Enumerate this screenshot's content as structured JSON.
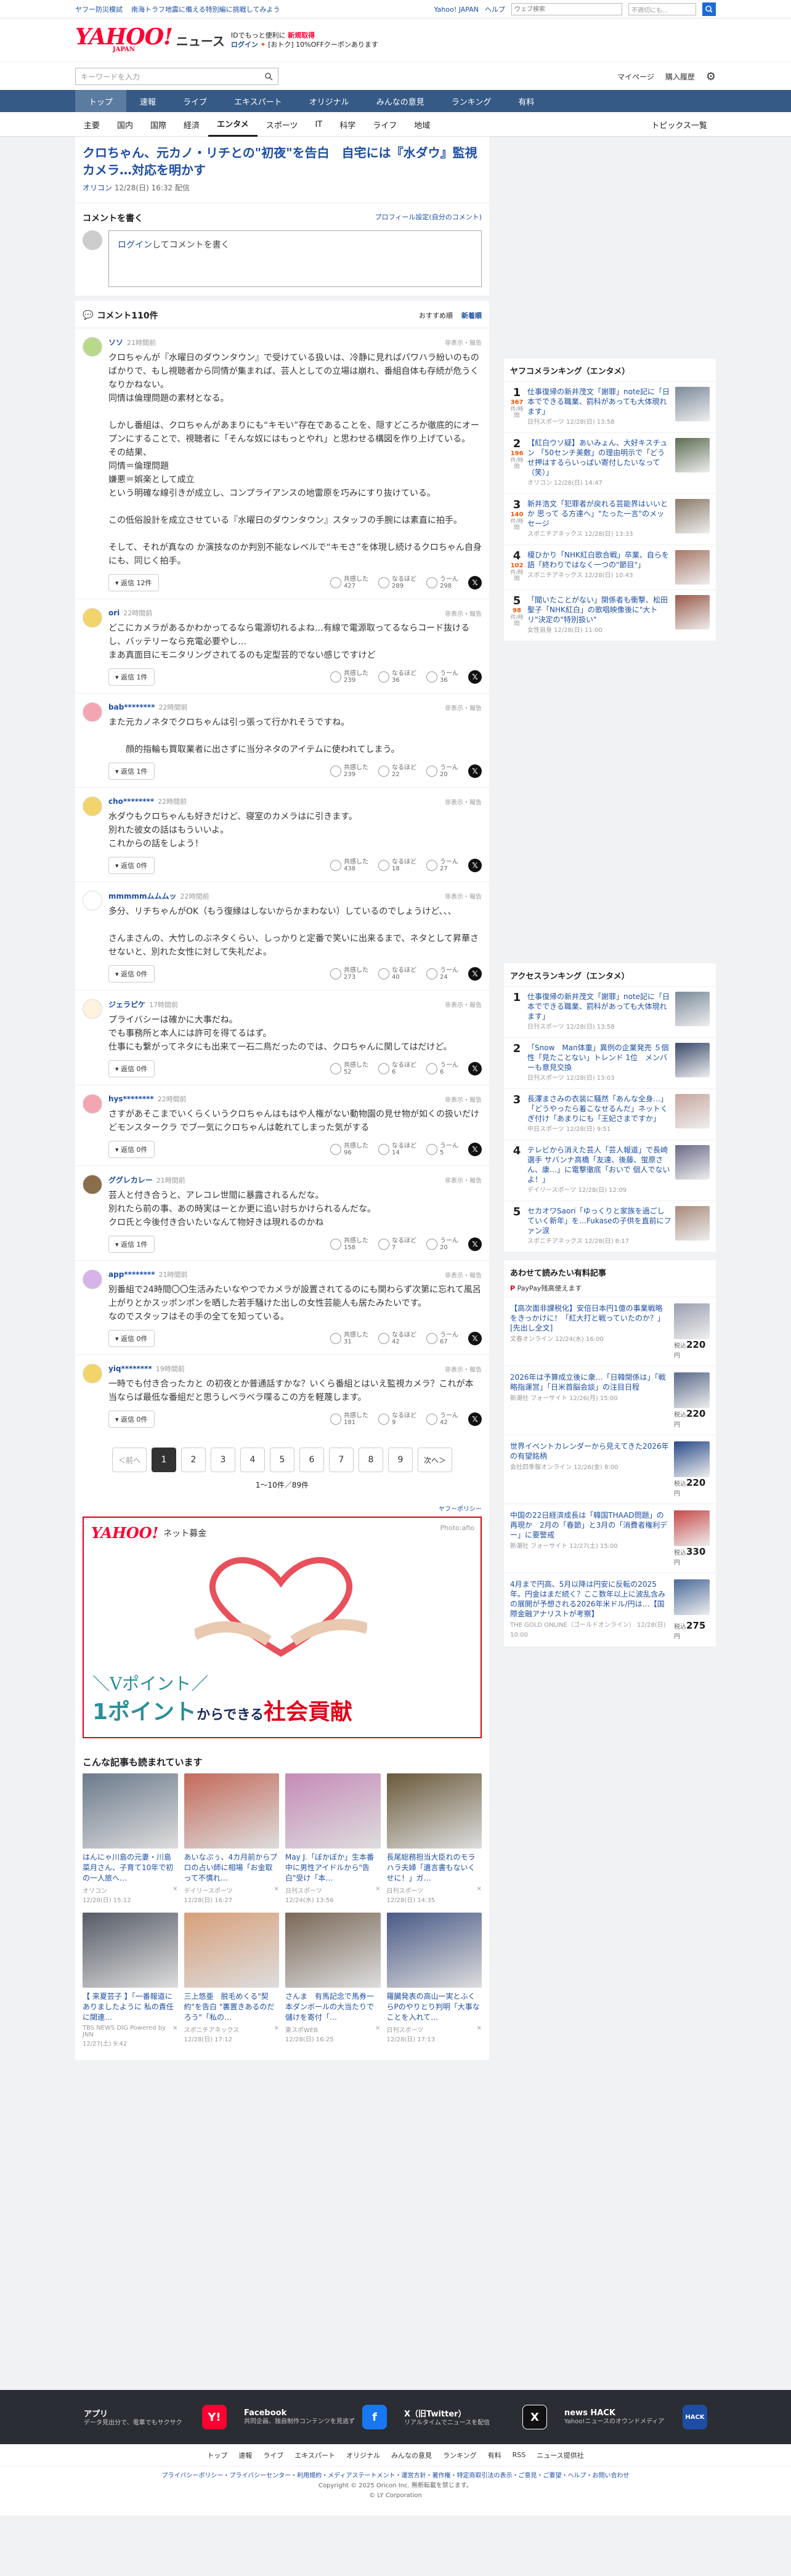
{
  "topbar": {
    "ticker": [
      "ヤフー防災模試",
      "南海トラフ地震に備える特別編に挑戦してみよう"
    ],
    "yahoo": "Yahoo! JAPAN",
    "help": "ヘルプ",
    "search_ph": "ウェブ検索",
    "toggle": "不適切にも..."
  },
  "header": {
    "logo": "YAHOO!",
    "logo_sub": "JAPAN",
    "news": "ニュース",
    "promo1": "IDでもっと便利に",
    "promo1b": "新規取得",
    "promo2": "ログイン",
    "promo3": "[おトク] 10%OFFクーポンあります"
  },
  "searchrow": {
    "ph": "キーワードを入力",
    "mypage": "マイページ",
    "history": "購入履歴"
  },
  "nav": [
    "トップ",
    "速報",
    "ライブ",
    "エキスパート",
    "オリジナル",
    "みんなの意見",
    "ランキング",
    "有料"
  ],
  "subnav": [
    "主要",
    "国内",
    "国際",
    "経済",
    "エンタメ",
    "スポーツ",
    "IT",
    "科学",
    "ライフ",
    "地域"
  ],
  "subnav_right": "トピックス一覧",
  "article": {
    "title": "クロちゃん、元カノ・リチとの\"初夜\"を告白　自宅には『水ダウ』監視カメラ…対応を明かす",
    "source": "オリコン",
    "time": "12/28(日) 16:32 配信"
  },
  "compose": {
    "title": "コメントを書く",
    "profile": "プロフィール設定(自分のコメント)",
    "login": "ログイン",
    "prompt": "してコメントを書く"
  },
  "clist": {
    "title": "コメント110件",
    "sort1": "おすすめ順",
    "sort2": "新着順"
  },
  "react_labels": [
    "共感した",
    "なるほど",
    "うーん"
  ],
  "comments": [
    {
      "user": "ソソ",
      "time": "21時間前",
      "report": "非表示・報告",
      "text": "クロちゃんが『水曜日のダウンタウン』で受けている扱いは、冷静に見ればパワハラ紛いのものばかりで、もし視聴者から同情が集まれば、芸人としての立場は崩れ、番組自体も存続が危うくなりかねない。\n同情は倫理問題の素材となる。\n\nしかし番組は、クロちゃんがあまりにも“キモい”存在であることを、隠すどころか徹底的にオープンにすることで、視聴者に「そんな奴にはもっとやれ」と思わせる構図を作り上げている。\nその結果、\n同情＝倫理問題\n嫌悪＝娯楽として成立\nという明確な線引きが成立し、コンプライアンスの地雷原を巧みにすり抜けている。\n\nこの低俗設計を成立させている『水曜日のダウンタウン』スタッフの手腕には素直に拍手。\n\nそして、それが真なの か演技なのか判別不能なレベルで“キモさ”を体現し続けるクロちゃん自身にも、同じく拍手。",
      "reply": "返信 12件",
      "a": "427",
      "b": "289",
      "c": "298",
      "av": "#b9d98a"
    },
    {
      "user": "ori",
      "time": "22時間前",
      "report": "非表示・報告",
      "text": "どこにカメラがあるかわかってるなら電源切れるよね…有線で電源取ってるならコード抜けるし、バッテリーなら充電必要やし…\nまあ真面目にモニタリングされてるのも定型芸的でない感じですけど",
      "reply": "返信 1件",
      "a": "239",
      "b": "36",
      "c": "36",
      "av": "#f2d46a"
    },
    {
      "user": "bab********",
      "time": "22時間前",
      "report": "非表示・報告",
      "text": "また元カノネタでクロちゃんは引っ張って行かれそうですね。\n\n　　顔的指輪も買取業者に出さずに当分ネタのアイテムに使われてしまう。",
      "reply": "返信 1件",
      "a": "239",
      "b": "22",
      "c": "20",
      "av": "#f3a6b2"
    },
    {
      "user": "cho********",
      "time": "22時間前",
      "report": "非表示・報告",
      "text": "水ダウもクロちゃんも好きだけど、寝室のカメラはに引きます。\n別れた彼女の話はもういいよ。\nこれからの話をしよう！",
      "reply": "返信 0件",
      "a": "438",
      "b": "18",
      "c": "27",
      "av": "#f2d46a"
    },
    {
      "user": "mmmmmムムムッ",
      "time": "22時間前",
      "report": "非表示・報告",
      "text": "多分、リチちゃんがOK（もう復縁はしないからかまわない）しているのでしょうけど、、、\n\nさんまさんの、大竹しのぶネタくらい、しっかりと定番で笑いに出来るまで、ネタとして昇華させないと、別れた女性に対して失礼だよ。",
      "reply": "返信 0件",
      "a": "273",
      "b": "40",
      "c": "24",
      "av": "#ffffff"
    },
    {
      "user": "ジェラピケ",
      "time": "17時間前",
      "report": "非表示・報告",
      "text": "プライバシーは確かに大事だね。\nでも事務所と本人には許可を得てるはず。\n仕事にも繋がってネタにも出来て一石二鳥だったのでは、クロちゃんに関してはだけど。",
      "reply": "返信 0件",
      "a": "52",
      "b": "6",
      "c": "6",
      "av": "#fff3e0"
    },
    {
      "user": "hys********",
      "time": "22時間前",
      "report": "非表示・報告",
      "text": "さすがあそこまでいくらくいうクロちゃんはもはや人権がない動物園の見せ物が如くの扱いだけどモンスタークラ でブ一気にクロちゃんは乾れてしまった気がする",
      "reply": "返信 0件",
      "a": "96",
      "b": "14",
      "c": "5",
      "av": "#f3a6b2"
    },
    {
      "user": "ググレカレー",
      "time": "21時間前",
      "report": "非表示・報告",
      "text": "芸人と付き合うと、アレコレ世間に暴露されるんだな。\n別れたら前の事、あの時実はーとか更に追い討ちかけられるんだな。\nクロ氏と今後付き合いたいなんて物好きは現れるのかね",
      "reply": "返信 1件",
      "a": "158",
      "b": "7",
      "c": "20",
      "av": "#8a6d4a"
    },
    {
      "user": "app********",
      "time": "21時間前",
      "report": "非表示・報告",
      "text": "別番組で24時間〇〇生活みたいなやつでカメラが設置されてるのにも関わらず次第に忘れて風呂上がりとかスッポンポンを晒した若手騒けた出しの女性芸能人も居たみたいです。\nなのでスタッフはその手の全てを知っている。",
      "reply": "返信 0件",
      "a": "31",
      "b": "42",
      "c": "67",
      "av": "#d6b3e8"
    },
    {
      "user": "yiq********",
      "time": "19時間前",
      "report": "非表示・報告",
      "text": "一時でも付き合ったカと の初夜とか普通話すかな？いくら番組とはいえ監視カメラ？これが本当ならば最低な番組だと思うしベラベラ喋るこの方を軽蔑します。",
      "reply": "返信 0件",
      "a": "181",
      "b": "9",
      "c": "42",
      "av": "#f2d46a"
    }
  ],
  "pager": {
    "prev": "＜前へ",
    "next": "次へ＞",
    "pages": [
      "1",
      "2",
      "3",
      "4",
      "5",
      "6",
      "7",
      "8",
      "9"
    ],
    "count": "1〜10件／89件"
  },
  "ad": {
    "policy": "ヤフーポリシー",
    "brand": "YAHOO!",
    "brand_sub": "ネット募金",
    "photo": "Photo:afio",
    "line1": "＼Vポイント／",
    "line2a": "1ポイント",
    "line2b": "からできる",
    "line2c": "社会貢献"
  },
  "recs_title": "こんな記事も読まれています",
  "recs": [
    {
      "t": "はんにゃ川島の元妻・川島菜月さん、子育て10年で初の一人旅へ…",
      "s": "オリコン",
      "d": "12/28(日) 15:12",
      "c": "#6b7a8c"
    },
    {
      "t": "あいなぷぅ、4カ月前からプロの占い師に相場「お金取って不慣れ…",
      "s": "デイリースポーツ",
      "d": "12/28(日) 16:27",
      "c": "#c46a5a"
    },
    {
      "t": "May J.「ぼかぼか」生本番中に男性アイドルから\"告白\"受け「本…",
      "s": "日刊スポーツ",
      "d": "12/24(水) 13:56",
      "c": "#c68ab8"
    },
    {
      "t": "長尾総務担当大臣れのモラハラ夫婦「遺言書もないくせに！」ガ…",
      "s": "日刊スポーツ",
      "d": "12/28(日) 14:35",
      "c": "#6a5a3a"
    },
    {
      "t": "【 来夏芸子 】「一番報道にありましたように 私の責任に関連…",
      "s": "TBS NEWS DIG Powered by JNN",
      "d": "12/27(土) 9:42",
      "c": "#555b66"
    },
    {
      "t": "三上悠亜　脱毛めくる\"契約\"を告白 \"裏置きあるのだろう\"「私の…",
      "s": "スポニチアネックス",
      "d": "12/28(日) 17:12",
      "c": "#d8a07a"
    },
    {
      "t": "さんま　有馬記念で馬券一本ダンボールの大当たりで儲けを寄付「…",
      "s": "東スポWEB",
      "d": "12/28(日) 16:25",
      "c": "#7a6858"
    },
    {
      "t": "羅臓発表の高山一実とふくらPのやりとり判明「大事なことを入れて…",
      "s": "日刊スポーツ",
      "d": "12/28(日) 17:13",
      "c": "#4a5a88"
    }
  ],
  "ranking_title": "ヤフコメランキング（エンタメ）",
  "ranking": [
    {
      "n": "1",
      "cnt": "367",
      "t": "仕事復帰の新井茂文「謝罪」note記に「日本でできる職業、罰科があっても大体現れます」",
      "src": "日刊スポーツ 12/28(日) 13:58",
      "c": "#7b8a9a"
    },
    {
      "n": "2",
      "cnt": "196",
      "t": "【紅白ウソ疑】あいみょん、大好キスチュン 「50センチ美敷」の理由明示で「どうせ押はするらいっぱい寄付したいなって（笑）」",
      "src": "オリコン 12/28(日) 14:47",
      "c": "#5b6d52"
    },
    {
      "n": "3",
      "cnt": "140",
      "t": "新井浩文「犯罪者が戻れる芸能界はいいとか 思って る方達へ」\"たった一言\"のメッセージ",
      "src": "スポニチアネックス 12/28(日) 13:33",
      "c": "#8a7a68"
    },
    {
      "n": "4",
      "cnt": "102",
      "t": "榎ひかり「NHK紅白歌合戦」卒業、自らを語「終わりではなく一つの\"節目\"」",
      "src": "スポニチアネックス 12/28(日) 10:43",
      "c": "#a87868"
    },
    {
      "n": "5",
      "cnt": "98",
      "t": "「聞いたことがない」関係者も衝撃、松田聖子「NHK紅白」の歌唱映像後に\"大トリ\"決定の\"特別扱い\"",
      "src": "女性自身 12/28(日) 11:00",
      "c": "#9a5a4a"
    }
  ],
  "ranking_unit": "件/時間",
  "access_title": "アクセスランキング（エンタメ）",
  "access": [
    {
      "n": "1",
      "t": "仕事復帰の新井茂文「謝罪」note記に「日本でできる職業、罰科があっても大体現れます」",
      "src": "日刊スポーツ 12/28(日) 13:58",
      "c": "#7b8a9a"
    },
    {
      "n": "2",
      "t": "「Snow　Man体重」異例の企業発売 ５個性「見たことない」トレンド 1位　メンバーも意見交換",
      "src": "日刊スポーツ 12/28(日) 13:03",
      "c": "#3a4a6a"
    },
    {
      "n": "3",
      "t": "長澤まさみの衣装に騒然「あんな全身…」「どうやったら着こなせるんだ」ネットくぎ付け「あまりにも「王妃さまですか」",
      "src": "中日スポーツ 12/28(日) 9:51",
      "c": "#c8a8a0"
    },
    {
      "n": "4",
      "t": "テレビから消えた芸人「芸人報道」で長崎選手 サバンナ高橋「友達、後藤、蛍原さん、康…」に電撃徹底「おいで 個人でないよ！」",
      "src": "デイリースポーツ 12/28(日) 12:09",
      "c": "#6a6a88"
    },
    {
      "n": "5",
      "t": "セカオワSaori「ゆっくりと家族を過ごしていく新年」を…Fukaseの子供を直前にファン涙",
      "src": "スポニチアネックス 12/28(日) 8:17",
      "c": "#a88a7a"
    }
  ],
  "shop_title": "あわせて読みたい有料記事",
  "paypay": "PayPay残高使えます",
  "shop": [
    {
      "t": "【高次面非課税化】安倍日本円1億の事業戦略をきっかけに！「紅大打と戦っていたのか？」[先出し全文]",
      "src": "文春オンライン 12/24(水) 16:00",
      "p": "220",
      "c": "#9aa0b0"
    },
    {
      "t": "2026年は予算成立後に衆…「日韓関係は」「戦略指運営」「日米首脳会談」の注目日程",
      "src": "新潮社 フォーサイト 12/26(月) 15:00",
      "p": "220",
      "c": "#5a6a8a"
    },
    {
      "t": "世界イベントカレンダーから見えてきた2026年の有望銘柄",
      "src": "会社四季報オンライン 12/26(金) 8:00",
      "p": "220",
      "c": "#2a4a8a"
    },
    {
      "t": "中国の22日経済成長は「韓国THAAD問題」の再現か　2月の「春節」と3月の「消費者権利デー」に要警戒",
      "src": "新潮社 フォーサイト 12/27(土) 15:00",
      "p": "330",
      "c": "#c84a4a"
    },
    {
      "t": "4月まで円高、5月以降は円安に反転の2025年。円金はまだ続く？ここ数年以上に波乱含みの展開が予想される2026年米ドル/円は…【国際金融アナリストが考察】",
      "src": "THE GOLD ONLINE（ゴールドオンライン） 12/28(日) 10:00",
      "p": "275",
      "c": "#4a6a9a"
    }
  ],
  "footer": {
    "apps": [
      {
        "t": "アプリ",
        "d": "データ見出分で、電車でもサクサク",
        "ic": "Y!"
      },
      {
        "t": "Facebook",
        "d": "共同企画、独自制作コンテンツを見逃ず",
        "ic": "f"
      },
      {
        "t": "X（旧Twitter）",
        "d": "リアルタイムでニュースを配信",
        "ic": "X"
      },
      {
        "t": "news HACK",
        "d": "Yahoo!ニュースのオウンドメディア",
        "ic": "HACK"
      }
    ],
    "links": [
      "トップ",
      "速報",
      "ライブ",
      "エキスパート",
      "オリジナル",
      "みんなの意見",
      "ランキング",
      "有料",
      "RSS",
      "ニュース提供社"
    ],
    "policy": "プライバシーポリシー・プライバシーセンター・利用規約・メディアステートメント・運営方針・著作権・特定商取引法の表示・ご意見・ご要望・ヘルプ・お問い合わせ",
    "copyright": "Copyright © 2025 Oricon Inc. 無断転載を禁じます。",
    "ly": "© LY Corporation"
  }
}
